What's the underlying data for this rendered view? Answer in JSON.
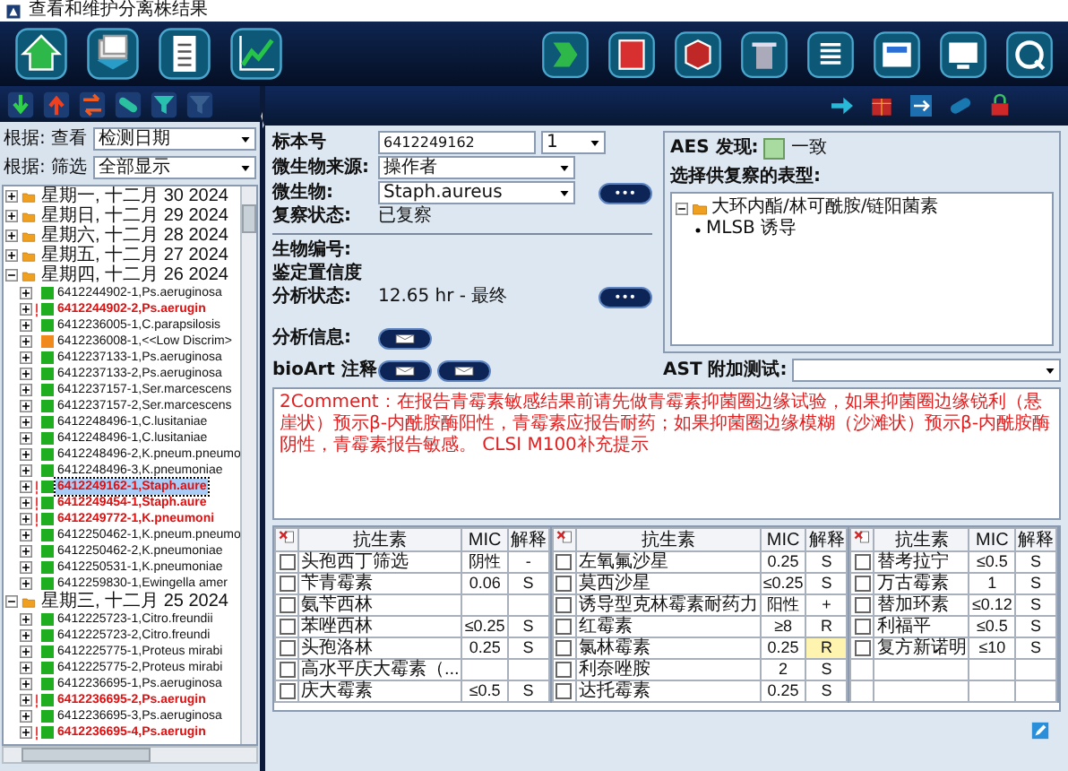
{
  "window": {
    "title": "查看和维护分离株结果"
  },
  "filters": [
    {
      "label": "根据: 查看",
      "value": "检测日期"
    },
    {
      "label": "根据: 筛选",
      "value": "全部显示"
    }
  ],
  "tree": [
    {
      "label": "星期一, 十二月 30 2024",
      "expanded": false
    },
    {
      "label": "星期日, 十二月 29 2024",
      "expanded": false
    },
    {
      "label": "星期六, 十二月 28 2024",
      "expanded": false
    },
    {
      "label": "星期五, 十二月 27 2024",
      "expanded": false
    },
    {
      "label": "星期四, 十二月 26 2024",
      "expanded": true,
      "children": [
        {
          "label": "6412244902-1,Ps.aeruginosa",
          "expanded": false,
          "flagged": false,
          "color": "#1fae1f",
          "selected": false
        },
        {
          "label": "6412244902-2,Ps.aerugin",
          "expanded": false,
          "flagged": true,
          "color": "#1fae1f",
          "selected": false
        },
        {
          "label": "6412236005-1,C.parapsilosis",
          "expanded": false,
          "flagged": false,
          "color": "#1fae1f",
          "selected": false
        },
        {
          "label": "6412236008-1,<<Low Discrim>",
          "expanded": false,
          "flagged": false,
          "color": "#f08a1c",
          "selected": false
        },
        {
          "label": "6412237133-1,Ps.aeruginosa",
          "expanded": false,
          "flagged": false,
          "color": "#1fae1f",
          "selected": false
        },
        {
          "label": "6412237133-2,Ps.aeruginosa",
          "expanded": false,
          "flagged": false,
          "color": "#1fae1f",
          "selected": false
        },
        {
          "label": "6412237157-1,Ser.marcescens",
          "expanded": false,
          "flagged": false,
          "color": "#1fae1f",
          "selected": false
        },
        {
          "label": "6412237157-2,Ser.marcescens",
          "expanded": false,
          "flagged": false,
          "color": "#1fae1f",
          "selected": false
        },
        {
          "label": "6412248496-1,C.lusitaniae",
          "expanded": false,
          "flagged": false,
          "color": "#1fae1f",
          "selected": false
        },
        {
          "label": "6412248496-1,C.lusitaniae",
          "expanded": false,
          "flagged": false,
          "color": "#1fae1f",
          "selected": false
        },
        {
          "label": "6412248496-2,K.pneum.pneumo",
          "expanded": false,
          "flagged": false,
          "color": "#1fae1f",
          "selected": false
        },
        {
          "label": "6412248496-3,K.pneumoniae",
          "expanded": false,
          "flagged": false,
          "color": "#1fae1f",
          "selected": false
        },
        {
          "label": "6412249162-1,Staph.aure",
          "expanded": false,
          "flagged": true,
          "color": "#1fae1f",
          "selected": true
        },
        {
          "label": "6412249454-1,Staph.aure",
          "expanded": false,
          "flagged": true,
          "color": "#1fae1f",
          "selected": false
        },
        {
          "label": "6412249772-1,K.pneumoni",
          "expanded": false,
          "flagged": true,
          "color": "#1fae1f",
          "selected": false
        },
        {
          "label": "6412250462-1,K.pneum.pneumo",
          "expanded": false,
          "flagged": false,
          "color": "#1fae1f",
          "selected": false
        },
        {
          "label": "6412250462-2,K.pneumoniae",
          "expanded": false,
          "flagged": false,
          "color": "#1fae1f",
          "selected": false
        },
        {
          "label": "6412250531-1,K.pneumoniae",
          "expanded": false,
          "flagged": false,
          "color": "#1fae1f",
          "selected": false
        },
        {
          "label": "6412259830-1,Ewingella amer",
          "expanded": false,
          "flagged": false,
          "color": "#1fae1f",
          "selected": false
        }
      ]
    },
    {
      "label": "星期三, 十二月 25 2024",
      "expanded": true,
      "children": [
        {
          "label": "6412225723-1,Citro.freundii",
          "expanded": false,
          "flagged": false,
          "color": "#1fae1f",
          "selected": false
        },
        {
          "label": "6412225723-2,Citro.freundi",
          "expanded": false,
          "flagged": false,
          "color": "#1fae1f",
          "selected": false
        },
        {
          "label": "6412225775-1,Proteus mirabi",
          "expanded": false,
          "flagged": false,
          "color": "#1fae1f",
          "selected": false
        },
        {
          "label": "6412225775-2,Proteus mirabi",
          "expanded": false,
          "flagged": false,
          "color": "#1fae1f",
          "selected": false
        },
        {
          "label": "6412236695-1,Ps.aeruginosa",
          "expanded": false,
          "flagged": false,
          "color": "#1fae1f",
          "selected": false
        },
        {
          "label": "6412236695-2,Ps.aerugin",
          "expanded": false,
          "flagged": true,
          "color": "#1fae1f",
          "selected": false
        },
        {
          "label": "6412236695-3,Ps.aeruginosa",
          "expanded": false,
          "flagged": false,
          "color": "#1fae1f",
          "selected": false
        },
        {
          "label": "6412236695-4,Ps.aerugin",
          "expanded": false,
          "flagged": true,
          "color": "#1fae1f",
          "selected": false
        }
      ]
    }
  ],
  "form": [
    {
      "kind": "input",
      "label": "标本号",
      "value": "6412249162",
      "select": "1"
    },
    {
      "kind": "select",
      "label": "微生物来源:",
      "value": "操作者"
    },
    {
      "kind": "select",
      "label": "微生物:",
      "value": "Staph.aureus",
      "button": "•••"
    },
    {
      "kind": "text",
      "label": "复察状态:",
      "value": "已复察"
    },
    {
      "kind": "divider"
    },
    {
      "kind": "text",
      "label": "生物编号:"
    },
    {
      "kind": "text",
      "label": "鉴定置信度"
    },
    {
      "kind": "text",
      "label": "分析状态:",
      "value": "12.65 hr - 最终",
      "button": "•••"
    },
    {
      "kind": "icon",
      "label": "分析信息:"
    }
  ],
  "aes": {
    "label": "AES 发现:",
    "result": "一致"
  },
  "phenotype": {
    "label": "选择供复察的表型:",
    "tree": [
      {
        "label": "大环内酯/林可酰胺/链阳菌素",
        "expanded": true,
        "children": [
          {
            "label": "MLSB 诱导"
          }
        ]
      }
    ]
  },
  "bioart": {
    "label": "bioArt 注释"
  },
  "ast_extra": {
    "label": "AST 附加测试:"
  },
  "comment": "2Comment：在报告青霉素敏感结果前请先做青霉素抑菌圈边缘试验，如果抑菌圈边缘锐利（悬崖状）预示β-内酰胺酶阳性，青霉素应报告耐药；如果抑菌圈边缘模糊（沙滩状）预示β-内酰胺酶阴性，青霉素报告敏感。        CLSI M100补充提示",
  "ast_table": {
    "groups": [
      {
        "columns": [
          "抗生素",
          "MIC",
          "解释"
        ],
        "rows": [
          {
            "checked": false,
            "antibiotic": "头孢西丁筛选",
            "mic": "阴性",
            "interpretation": "-",
            "highlighted": false
          },
          {
            "checked": false,
            "antibiotic": "苄青霉素",
            "mic": "0.06",
            "interpretation": "S",
            "highlighted": false
          },
          {
            "checked": false,
            "antibiotic": "氨苄西林",
            "highlighted": false
          },
          {
            "checked": false,
            "antibiotic": "苯唑西林",
            "mic": "≤0.25",
            "interpretation": "S",
            "highlighted": false
          },
          {
            "checked": false,
            "antibiotic": "头孢洛林",
            "mic": "0.25",
            "interpretation": "S",
            "highlighted": false
          },
          {
            "checked": false,
            "antibiotic": "高水平庆大霉素（...",
            "highlighted": false
          },
          {
            "checked": false,
            "antibiotic": "庆大霉素",
            "mic": "≤0.5",
            "interpretation": "S",
            "highlighted": false
          }
        ]
      },
      {
        "columns": [
          "抗生素",
          "MIC",
          "解释"
        ],
        "rows": [
          {
            "checked": false,
            "antibiotic": "左氧氟沙星",
            "mic": "0.25",
            "interpretation": "S",
            "highlighted": false
          },
          {
            "checked": false,
            "antibiotic": "莫西沙星",
            "mic": "≤0.25",
            "interpretation": "S",
            "highlighted": false
          },
          {
            "checked": false,
            "antibiotic": "诱导型克林霉素耐药力",
            "mic": "阳性",
            "interpretation": "+",
            "highlighted": false
          },
          {
            "checked": false,
            "antibiotic": "红霉素",
            "mic": "≥8",
            "interpretation": "R",
            "highlighted": false
          },
          {
            "checked": false,
            "antibiotic": "氯林霉素",
            "mic": "0.25",
            "interpretation": "R",
            "highlighted": true
          },
          {
            "checked": false,
            "antibiotic": "利奈唑胺",
            "mic": "2",
            "interpretation": "S",
            "highlighted": false
          },
          {
            "checked": false,
            "antibiotic": "达托霉素",
            "mic": "0.25",
            "interpretation": "S",
            "highlighted": false
          }
        ]
      },
      {
        "columns": [
          "抗生素",
          "MIC",
          "解释"
        ],
        "rows": [
          {
            "checked": false,
            "antibiotic": "替考拉宁",
            "mic": "≤0.5",
            "interpretation": "S",
            "highlighted": false
          },
          {
            "checked": false,
            "antibiotic": "万古霉素",
            "mic": "1",
            "interpretation": "S",
            "highlighted": false
          },
          {
            "checked": false,
            "antibiotic": "替加环素",
            "mic": "≤0.12",
            "interpretation": "S",
            "highlighted": false
          },
          {
            "checked": false,
            "antibiotic": "利福平",
            "mic": "≤0.5",
            "interpretation": "S",
            "highlighted": false
          },
          {
            "checked": false,
            "antibiotic": "复方新诺明",
            "mic": "≤10",
            "interpretation": "S",
            "highlighted": false
          }
        ]
      }
    ]
  }
}
